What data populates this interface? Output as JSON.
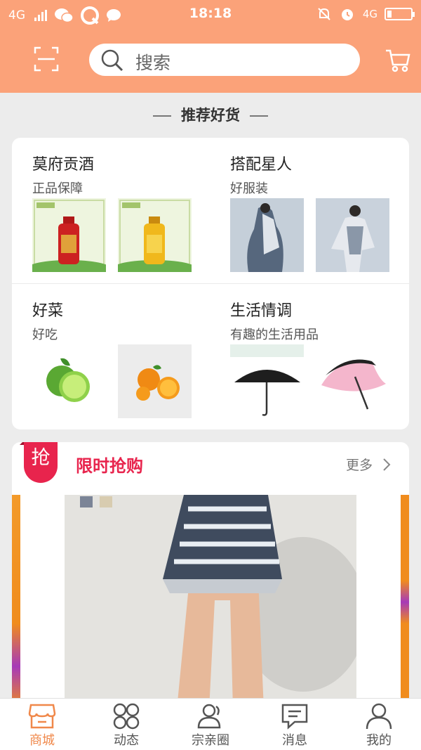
{
  "status_bar": {
    "network": "4G",
    "network_right": "4G",
    "time": "18:18",
    "icons_left": [
      "signal-icon",
      "wechat-icon",
      "qq-icon",
      "message-icon"
    ],
    "icons_right": [
      "mute-icon",
      "alarm-icon",
      "battery-icon"
    ]
  },
  "header": {
    "search_placeholder": "搜索",
    "accent": "#fba279"
  },
  "recommend": {
    "title": "推荐好货",
    "cells": [
      {
        "title": "莫府贡酒",
        "subtitle": "正品保障"
      },
      {
        "title": "搭配星人",
        "subtitle": "好服装"
      },
      {
        "title": "好菜",
        "subtitle": "好吃"
      },
      {
        "title": "生活情调",
        "subtitle": "有趣的生活用品"
      }
    ]
  },
  "flash_sale": {
    "badge": "抢",
    "title": "限时抢购",
    "more": "更多",
    "accent": "#e8244d"
  },
  "nav": {
    "items": [
      {
        "label": "商城",
        "icon": "store-icon",
        "active": true
      },
      {
        "label": "动态",
        "icon": "grid-icon",
        "active": false
      },
      {
        "label": "宗亲圈",
        "icon": "people-icon",
        "active": false
      },
      {
        "label": "消息",
        "icon": "chat-icon",
        "active": false
      },
      {
        "label": "我的",
        "icon": "person-icon",
        "active": false
      }
    ],
    "active_color": "#f0884a"
  }
}
